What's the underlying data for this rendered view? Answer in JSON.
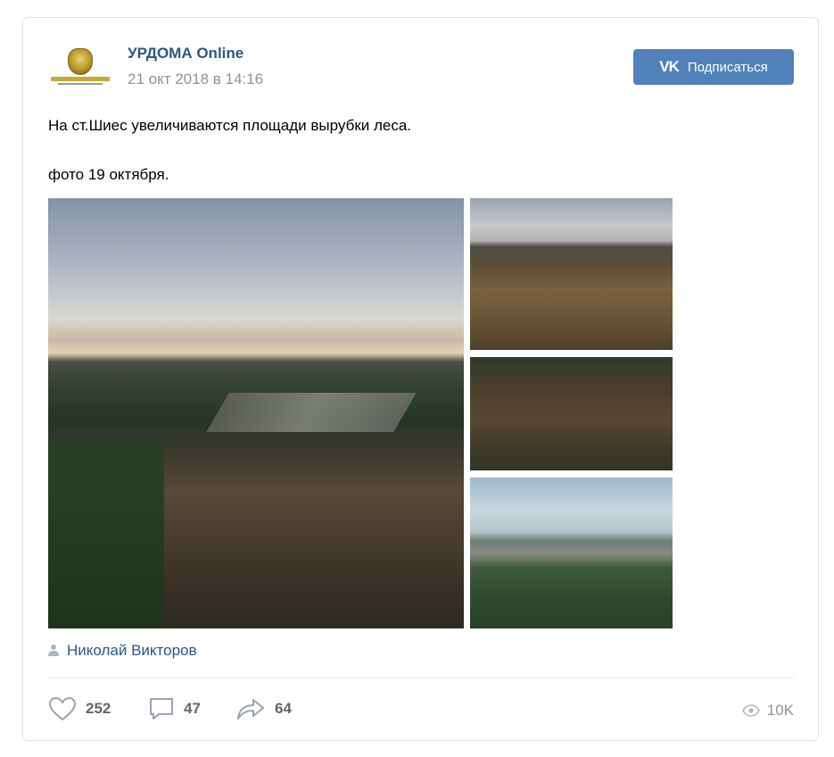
{
  "post": {
    "author": "УРДОМА Online",
    "date": "21 окт 2018 в 14:16",
    "subscribe_label": "Подписаться",
    "subscribe_icon": "vk-logo-icon",
    "text_line1": "На ст.Шиес увеличиваются площади вырубки леса.",
    "text_line2": "фото 19 октября.",
    "signer": "Николай Викторов",
    "photos": [
      {
        "name": "aerial-clearcut-photo-main"
      },
      {
        "name": "aerial-clearcut-photo-2"
      },
      {
        "name": "aerial-clearcut-photo-3"
      },
      {
        "name": "aerial-clearcut-photo-4"
      }
    ]
  },
  "actions": {
    "likes": "252",
    "comments": "47",
    "shares": "64",
    "views": "10K"
  },
  "colors": {
    "link": "#2a5885",
    "button": "#5181b8",
    "muted": "#939393",
    "count": "#656565",
    "border": "#dce1e6"
  }
}
